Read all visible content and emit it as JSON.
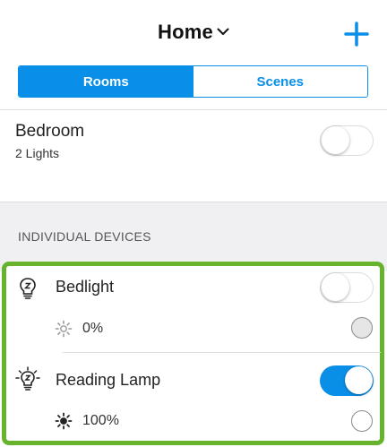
{
  "header": {
    "title": "Home",
    "title_icon": "chevron-down-icon",
    "add_icon": "plus-icon"
  },
  "tabs": [
    {
      "label": "Rooms",
      "active": true
    },
    {
      "label": "Scenes",
      "active": false
    }
  ],
  "room": {
    "name": "Bedroom",
    "subtitle": "2 Lights",
    "toggle_on": false
  },
  "section": {
    "label": "INDIVIDUAL DEVICES"
  },
  "devices": [
    {
      "name": "Bedlight",
      "icon": "bulb-off-icon",
      "brightness": "0%",
      "toggle_on": false
    },
    {
      "name": "Reading Lamp",
      "icon": "bulb-on-icon",
      "brightness": "100%",
      "toggle_on": true
    }
  ],
  "colors": {
    "accent": "#0a8fe8",
    "highlight": "#66b32e"
  }
}
